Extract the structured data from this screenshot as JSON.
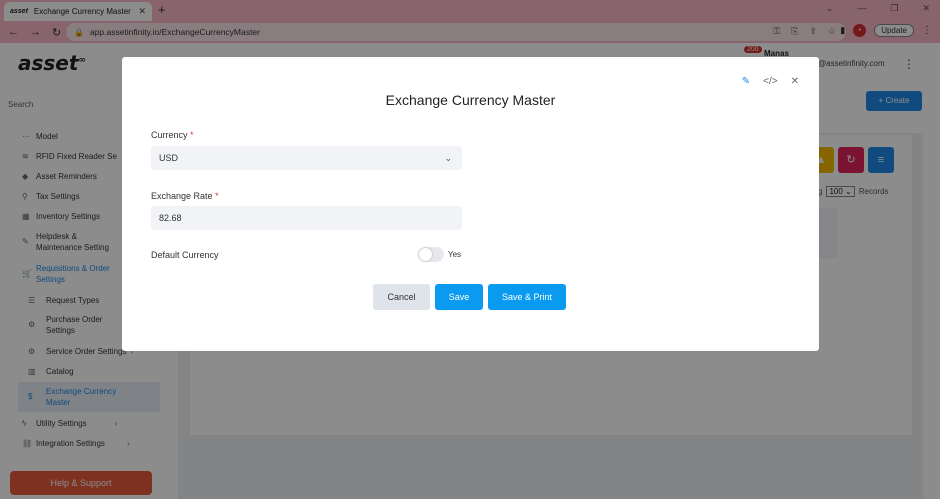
{
  "browser": {
    "tab_title": "Exchange Currency Master",
    "tab_favicon": "asset",
    "url": "app.assetinfinity.io/ExchangeCurrencyMaster",
    "update_label": "Update",
    "profile_initial": "•"
  },
  "header": {
    "logo": "asset",
    "logo_sup": "∞",
    "search_placeholder": "Search",
    "user_name": "Manas",
    "notification_count": "200",
    "email": "@assetinfinity.com",
    "create_label": "+ Create"
  },
  "sidebar": {
    "items": [
      {
        "label": "Model",
        "icon": "dots-icon"
      },
      {
        "label": "RFID Fixed Reader Se",
        "icon": "wifi-icon"
      },
      {
        "label": "Asset Reminders",
        "icon": "bell-icon"
      },
      {
        "label": "Tax Settings",
        "icon": "search-icon"
      },
      {
        "label": "Inventory Settings",
        "icon": "boxes-icon"
      },
      {
        "label": "Helpdesk &",
        "label2": "Maintenance Setting",
        "icon": "wrench-icon"
      },
      {
        "label": "Requisitions & Order",
        "label2": "Settings",
        "icon": "cart-icon"
      },
      {
        "label": "Request Types",
        "icon": "list-icon"
      },
      {
        "label": "Purchase Order",
        "label2": "Settings",
        "icon": "gear-icon"
      },
      {
        "label": "Service Order Settings",
        "icon": "gear-icon"
      },
      {
        "label": "Catalog",
        "icon": "book-icon"
      },
      {
        "label": "Exchange Currency",
        "label2": "Master",
        "icon": "dollar-icon"
      },
      {
        "label": "Utility Settings",
        "icon": "bolt-icon"
      },
      {
        "label": "Integration Settings",
        "icon": "link-icon"
      }
    ],
    "help_label": "Help & Support"
  },
  "content": {
    "records_prefix": "g",
    "records_value": "100",
    "records_label": "Records"
  },
  "modal": {
    "title": "Exchange Currency Master",
    "currency_label": "Currency",
    "currency_value": "USD",
    "rate_label": "Exchange Rate",
    "rate_value": "82.68",
    "default_label": "Default Currency",
    "default_toggle_label": "Yes",
    "default_on": false,
    "cancel_label": "Cancel",
    "save_label": "Save",
    "save_print_label": "Save & Print",
    "required_mark": "*"
  },
  "colors": {
    "primary": "#0a9bf0",
    "browser_chrome": "#f7b6c6",
    "help": "#e65a3c"
  }
}
